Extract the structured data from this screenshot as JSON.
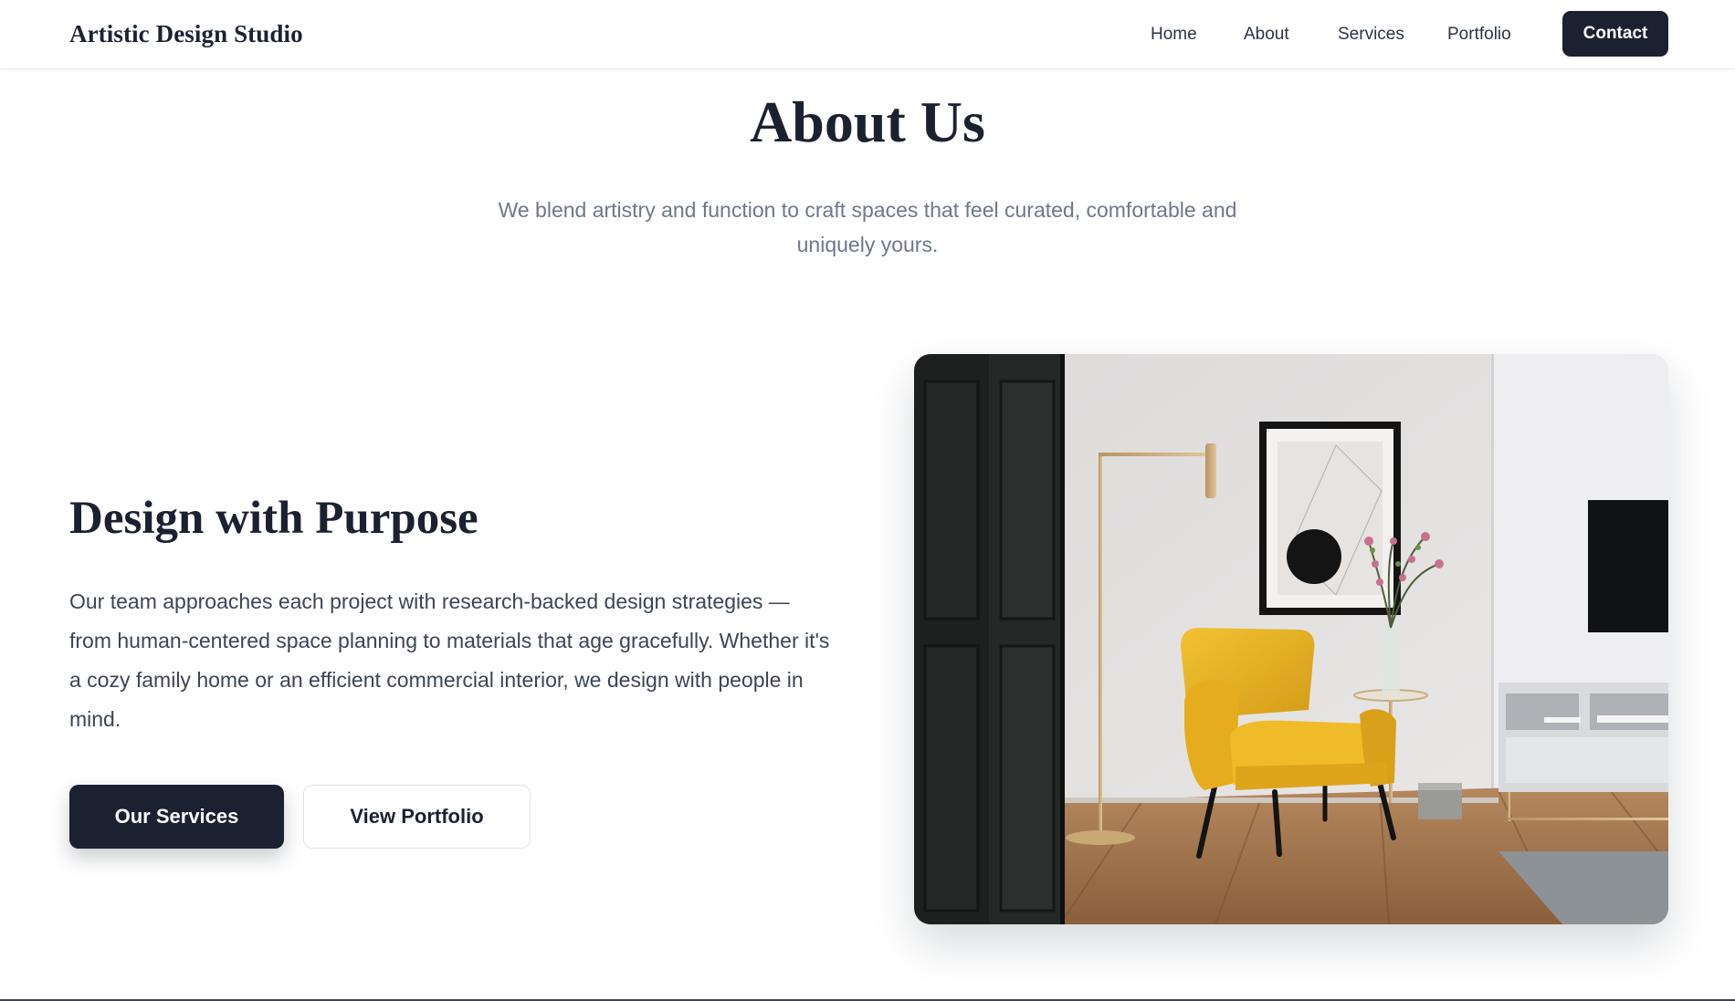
{
  "header": {
    "brand": "Artistic Design Studio",
    "nav": {
      "home": "Home",
      "about": "About",
      "services": "Services",
      "portfolio": "Portfolio",
      "contact": "Contact"
    }
  },
  "hero": {
    "title": "About Us",
    "subtitle": "We blend artistry and function to craft spaces that feel curated, comfortable and uniquely yours."
  },
  "section": {
    "heading": "Design with Purpose",
    "body": "Our team approaches each project with research-backed design strategies — from human-centered space planning to materials that age gracefully. Whether it's a cozy family home or an efficient commercial interior, we design with people in mind.",
    "primary_button": "Our Services",
    "secondary_button": "View Portfolio"
  },
  "colors": {
    "primary": "#1b2130",
    "accent_chair": "#e8b322",
    "text_muted": "#6e7888"
  }
}
